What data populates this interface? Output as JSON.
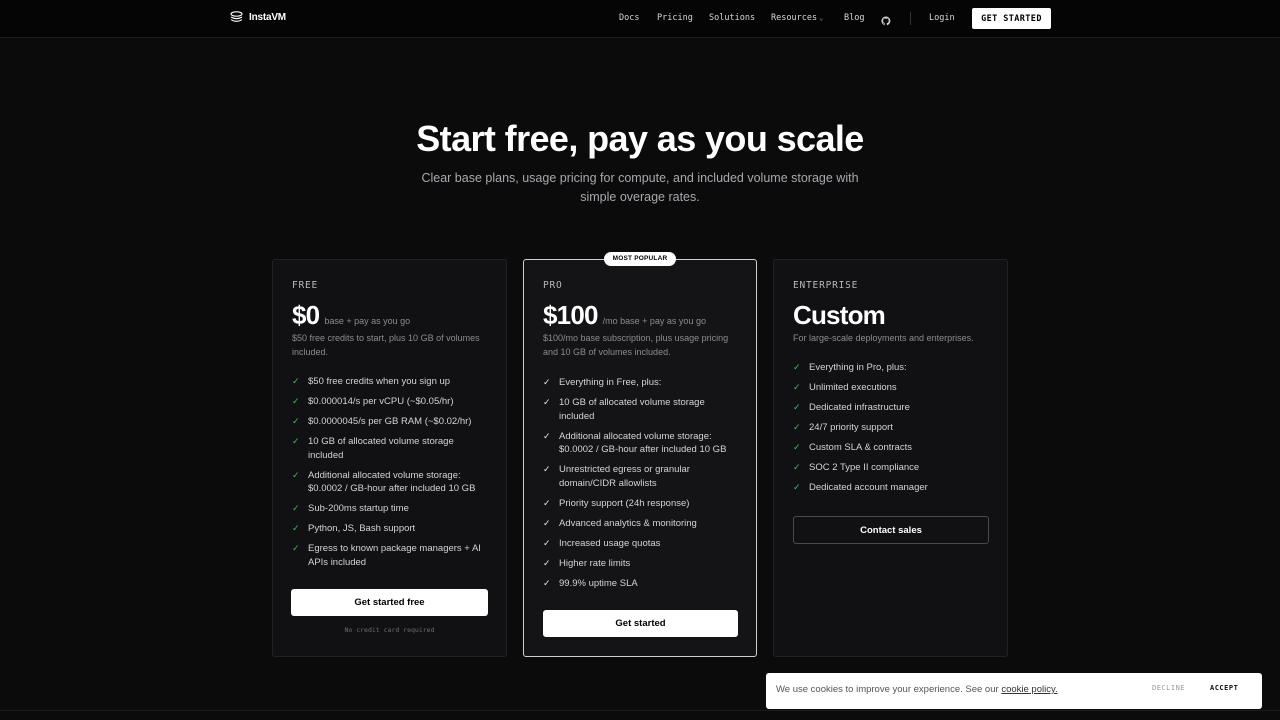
{
  "nav": {
    "logo_text": "InstaVM",
    "links": [
      "Docs",
      "Pricing",
      "Solutions",
      "Resources",
      "Blog"
    ],
    "login": "Login",
    "cta": "GET STARTED"
  },
  "hero": {
    "title": "Start free, pay as you scale",
    "subtitle": "Clear base plans, usage pricing for compute, and included volume storage with simple overage rates."
  },
  "plans": {
    "free": {
      "name": "FREE",
      "price": "$0",
      "price_suffix": "base + pay as you go",
      "description": "$50 free credits to start, plus 10 GB of volumes included.",
      "features": [
        "$50 free credits when you sign up",
        "$0.000014/s per vCPU (~$0.05/hr)",
        "$0.0000045/s per GB RAM (~$0.02/hr)",
        "10 GB of allocated volume storage included",
        "Additional allocated volume storage: $0.0002 / GB-hour after included 10 GB",
        "Sub-200ms startup time",
        "Python, JS, Bash support",
        "Egress to known package managers + AI APIs included"
      ],
      "cta": "Get started free",
      "note": "No credit card required"
    },
    "pro": {
      "badge": "MOST POPULAR",
      "name": "PRO",
      "price": "$100",
      "price_suffix": "/mo base + pay as you go",
      "description": "$100/mo base subscription, plus usage pricing and 10 GB of volumes included.",
      "features": [
        "Everything in Free, plus:",
        "10 GB of allocated volume storage included",
        "Additional allocated volume storage: $0.0002 / GB-hour after included 10 GB",
        "Unrestricted egress or granular domain/CIDR allowlists",
        "Priority support (24h response)",
        "Advanced analytics & monitoring",
        "Increased usage quotas",
        "Higher rate limits",
        "99.9% uptime SLA"
      ],
      "cta": "Get started"
    },
    "enterprise": {
      "name": "ENTERPRISE",
      "price": "Custom",
      "description": "For large-scale deployments and enterprises.",
      "features": [
        "Everything in Pro, plus:",
        "Unlimited executions",
        "Dedicated infrastructure",
        "24/7 priority support",
        "Custom SLA & contracts",
        "SOC 2 Type II compliance",
        "Dedicated account manager"
      ],
      "cta": "Contact sales"
    }
  },
  "cookie": {
    "text": "We use cookies to improve your experience. See our",
    "link": "cookie policy.",
    "decline": "DECLINE",
    "accept": "ACCEPT"
  },
  "colors": {
    "background": "#0b0b0c",
    "check_green": "#3fbf6a"
  }
}
